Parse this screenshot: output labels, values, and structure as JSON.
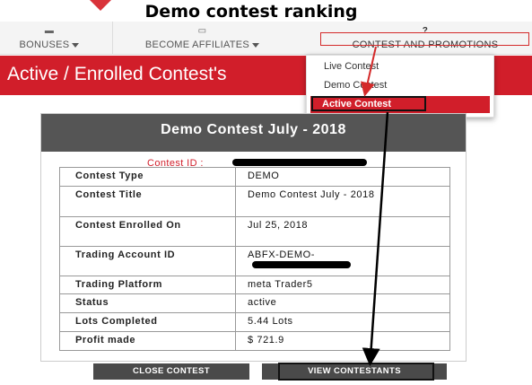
{
  "annotation": {
    "title": "Demo contest ranking"
  },
  "nav": {
    "bonuses": "BONUSES",
    "affiliates": "BECOME AFFILIATES",
    "contest": "CONTEST AND PROMOTIONS",
    "contest_icon_glyph": "?",
    "affiliates_icon_glyph": "▭",
    "bonuses_icon_glyph": "▬"
  },
  "banner": {
    "title": "Active / Enrolled Contest's"
  },
  "dropdown": {
    "items": [
      "Live Contest",
      "Demo Contest",
      "Active Contest"
    ]
  },
  "card": {
    "title": "Demo Contest July - 2018",
    "contest_id_label": "Contest ID :",
    "rows": [
      {
        "label": "Contest Type",
        "value": "DEMO"
      },
      {
        "label": "Contest Title",
        "value": "Demo Contest July - 2018"
      },
      {
        "label": "Contest Enrolled On",
        "value": "Jul 25, 2018"
      },
      {
        "label": "Trading Account ID",
        "value": "ABFX-DEMO-"
      },
      {
        "label": "Trading Platform",
        "value": "meta Trader5"
      },
      {
        "label": "Status",
        "value": "active"
      },
      {
        "label": "Lots Completed",
        "value": "5.44 Lots"
      },
      {
        "label": "Profit made",
        "value": "$ 721.9"
      }
    ]
  },
  "buttons": {
    "close": "CLOSE CONTEST",
    "view": "VIEW CONTESTANTS"
  },
  "colors": {
    "brand_red": "#d11e2a",
    "header_gray": "#555555",
    "button_gray": "#4a4a4a"
  }
}
